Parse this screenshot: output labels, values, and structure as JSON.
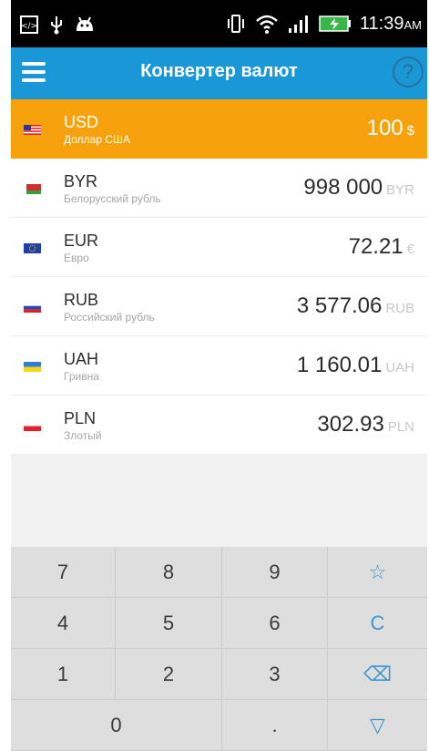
{
  "status_bar": {
    "time": "11:39",
    "ampm": "AM"
  },
  "app_bar": {
    "title": "Конвертер валют",
    "help_label": "?"
  },
  "currencies": [
    {
      "code": "USD",
      "name": "Доллар США",
      "amount": "100",
      "unit": "$"
    },
    {
      "code": "BYR",
      "name": "Белорусский рубль",
      "amount": "998 000",
      "unit": "BYR"
    },
    {
      "code": "EUR",
      "name": "Евро",
      "amount": "72.21",
      "unit": "€"
    },
    {
      "code": "RUB",
      "name": "Российский рубль",
      "amount": "3 577.06",
      "unit": "RUB"
    },
    {
      "code": "UAH",
      "name": "Гривна",
      "amount": "1 160.01",
      "unit": "UAH"
    },
    {
      "code": "PLN",
      "name": "Злотый",
      "amount": "302.93",
      "unit": "PLN"
    }
  ],
  "keypad": {
    "digits": [
      "7",
      "8",
      "9",
      "4",
      "5",
      "6",
      "1",
      "2",
      "3",
      "0",
      "."
    ],
    "actions": {
      "favorite": "☆",
      "clear": "C",
      "backspace": "⌫",
      "more": "▽"
    }
  },
  "colors": {
    "app_bar": "#1a97d6",
    "selected_row": "#f7a20c",
    "accent": "#3c98d4"
  }
}
